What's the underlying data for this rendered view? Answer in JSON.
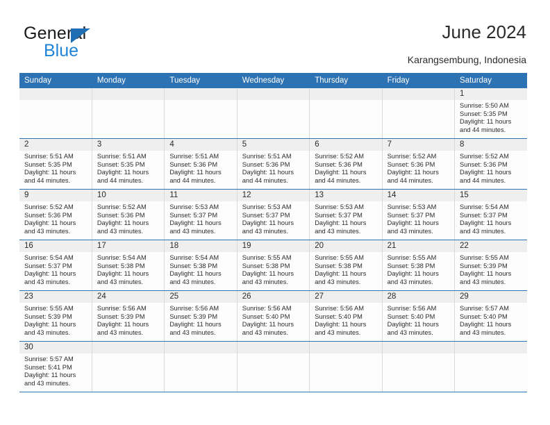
{
  "brand": {
    "name_top": "General",
    "name_bottom": "Blue",
    "accent_blue": "#1f83d8",
    "triangle_blue": "#1f6db5"
  },
  "header": {
    "title": "June 2024",
    "subtitle": "Karangsembung, Indonesia"
  },
  "calendar": {
    "header_bg": "#2d72b3",
    "weekdays": [
      "Sunday",
      "Monday",
      "Tuesday",
      "Wednesday",
      "Thursday",
      "Friday",
      "Saturday"
    ],
    "weeks": [
      [
        {
          "day": "",
          "sunrise": "",
          "sunset": "",
          "daylight": ""
        },
        {
          "day": "",
          "sunrise": "",
          "sunset": "",
          "daylight": ""
        },
        {
          "day": "",
          "sunrise": "",
          "sunset": "",
          "daylight": ""
        },
        {
          "day": "",
          "sunrise": "",
          "sunset": "",
          "daylight": ""
        },
        {
          "day": "",
          "sunrise": "",
          "sunset": "",
          "daylight": ""
        },
        {
          "day": "",
          "sunrise": "",
          "sunset": "",
          "daylight": ""
        },
        {
          "day": "1",
          "sunrise": "Sunrise: 5:50 AM",
          "sunset": "Sunset: 5:35 PM",
          "daylight": "Daylight: 11 hours and 44 minutes."
        }
      ],
      [
        {
          "day": "2",
          "sunrise": "Sunrise: 5:51 AM",
          "sunset": "Sunset: 5:35 PM",
          "daylight": "Daylight: 11 hours and 44 minutes."
        },
        {
          "day": "3",
          "sunrise": "Sunrise: 5:51 AM",
          "sunset": "Sunset: 5:35 PM",
          "daylight": "Daylight: 11 hours and 44 minutes."
        },
        {
          "day": "4",
          "sunrise": "Sunrise: 5:51 AM",
          "sunset": "Sunset: 5:36 PM",
          "daylight": "Daylight: 11 hours and 44 minutes."
        },
        {
          "day": "5",
          "sunrise": "Sunrise: 5:51 AM",
          "sunset": "Sunset: 5:36 PM",
          "daylight": "Daylight: 11 hours and 44 minutes."
        },
        {
          "day": "6",
          "sunrise": "Sunrise: 5:52 AM",
          "sunset": "Sunset: 5:36 PM",
          "daylight": "Daylight: 11 hours and 44 minutes."
        },
        {
          "day": "7",
          "sunrise": "Sunrise: 5:52 AM",
          "sunset": "Sunset: 5:36 PM",
          "daylight": "Daylight: 11 hours and 44 minutes."
        },
        {
          "day": "8",
          "sunrise": "Sunrise: 5:52 AM",
          "sunset": "Sunset: 5:36 PM",
          "daylight": "Daylight: 11 hours and 44 minutes."
        }
      ],
      [
        {
          "day": "9",
          "sunrise": "Sunrise: 5:52 AM",
          "sunset": "Sunset: 5:36 PM",
          "daylight": "Daylight: 11 hours and 43 minutes."
        },
        {
          "day": "10",
          "sunrise": "Sunrise: 5:52 AM",
          "sunset": "Sunset: 5:36 PM",
          "daylight": "Daylight: 11 hours and 43 minutes."
        },
        {
          "day": "11",
          "sunrise": "Sunrise: 5:53 AM",
          "sunset": "Sunset: 5:37 PM",
          "daylight": "Daylight: 11 hours and 43 minutes."
        },
        {
          "day": "12",
          "sunrise": "Sunrise: 5:53 AM",
          "sunset": "Sunset: 5:37 PM",
          "daylight": "Daylight: 11 hours and 43 minutes."
        },
        {
          "day": "13",
          "sunrise": "Sunrise: 5:53 AM",
          "sunset": "Sunset: 5:37 PM",
          "daylight": "Daylight: 11 hours and 43 minutes."
        },
        {
          "day": "14",
          "sunrise": "Sunrise: 5:53 AM",
          "sunset": "Sunset: 5:37 PM",
          "daylight": "Daylight: 11 hours and 43 minutes."
        },
        {
          "day": "15",
          "sunrise": "Sunrise: 5:54 AM",
          "sunset": "Sunset: 5:37 PM",
          "daylight": "Daylight: 11 hours and 43 minutes."
        }
      ],
      [
        {
          "day": "16",
          "sunrise": "Sunrise: 5:54 AM",
          "sunset": "Sunset: 5:37 PM",
          "daylight": "Daylight: 11 hours and 43 minutes."
        },
        {
          "day": "17",
          "sunrise": "Sunrise: 5:54 AM",
          "sunset": "Sunset: 5:38 PM",
          "daylight": "Daylight: 11 hours and 43 minutes."
        },
        {
          "day": "18",
          "sunrise": "Sunrise: 5:54 AM",
          "sunset": "Sunset: 5:38 PM",
          "daylight": "Daylight: 11 hours and 43 minutes."
        },
        {
          "day": "19",
          "sunrise": "Sunrise: 5:55 AM",
          "sunset": "Sunset: 5:38 PM",
          "daylight": "Daylight: 11 hours and 43 minutes."
        },
        {
          "day": "20",
          "sunrise": "Sunrise: 5:55 AM",
          "sunset": "Sunset: 5:38 PM",
          "daylight": "Daylight: 11 hours and 43 minutes."
        },
        {
          "day": "21",
          "sunrise": "Sunrise: 5:55 AM",
          "sunset": "Sunset: 5:38 PM",
          "daylight": "Daylight: 11 hours and 43 minutes."
        },
        {
          "day": "22",
          "sunrise": "Sunrise: 5:55 AM",
          "sunset": "Sunset: 5:39 PM",
          "daylight": "Daylight: 11 hours and 43 minutes."
        }
      ],
      [
        {
          "day": "23",
          "sunrise": "Sunrise: 5:55 AM",
          "sunset": "Sunset: 5:39 PM",
          "daylight": "Daylight: 11 hours and 43 minutes."
        },
        {
          "day": "24",
          "sunrise": "Sunrise: 5:56 AM",
          "sunset": "Sunset: 5:39 PM",
          "daylight": "Daylight: 11 hours and 43 minutes."
        },
        {
          "day": "25",
          "sunrise": "Sunrise: 5:56 AM",
          "sunset": "Sunset: 5:39 PM",
          "daylight": "Daylight: 11 hours and 43 minutes."
        },
        {
          "day": "26",
          "sunrise": "Sunrise: 5:56 AM",
          "sunset": "Sunset: 5:40 PM",
          "daylight": "Daylight: 11 hours and 43 minutes."
        },
        {
          "day": "27",
          "sunrise": "Sunrise: 5:56 AM",
          "sunset": "Sunset: 5:40 PM",
          "daylight": "Daylight: 11 hours and 43 minutes."
        },
        {
          "day": "28",
          "sunrise": "Sunrise: 5:56 AM",
          "sunset": "Sunset: 5:40 PM",
          "daylight": "Daylight: 11 hours and 43 minutes."
        },
        {
          "day": "29",
          "sunrise": "Sunrise: 5:57 AM",
          "sunset": "Sunset: 5:40 PM",
          "daylight": "Daylight: 11 hours and 43 minutes."
        }
      ],
      [
        {
          "day": "30",
          "sunrise": "Sunrise: 5:57 AM",
          "sunset": "Sunset: 5:41 PM",
          "daylight": "Daylight: 11 hours and 43 minutes."
        },
        {
          "day": "",
          "sunrise": "",
          "sunset": "",
          "daylight": ""
        },
        {
          "day": "",
          "sunrise": "",
          "sunset": "",
          "daylight": ""
        },
        {
          "day": "",
          "sunrise": "",
          "sunset": "",
          "daylight": ""
        },
        {
          "day": "",
          "sunrise": "",
          "sunset": "",
          "daylight": ""
        },
        {
          "day": "",
          "sunrise": "",
          "sunset": "",
          "daylight": ""
        },
        {
          "day": "",
          "sunrise": "",
          "sunset": "",
          "daylight": ""
        }
      ]
    ]
  }
}
